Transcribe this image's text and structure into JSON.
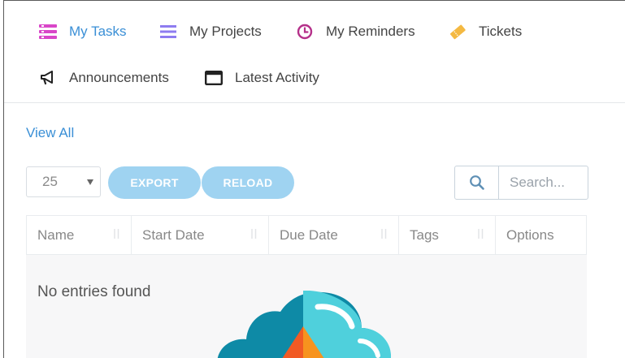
{
  "tabs": [
    {
      "label": "My Tasks",
      "icon": "tasks-icon",
      "active": true
    },
    {
      "label": "My Projects",
      "icon": "projects-icon",
      "active": false
    },
    {
      "label": "My Reminders",
      "icon": "clock-icon",
      "active": false
    },
    {
      "label": "Tickets",
      "icon": "ticket-icon",
      "active": false
    },
    {
      "label": "Announcements",
      "icon": "megaphone-icon",
      "active": false
    },
    {
      "label": "Latest Activity",
      "icon": "window-icon",
      "active": false
    }
  ],
  "view_all": "View All",
  "length_select": {
    "value": "25"
  },
  "buttons": {
    "export": "EXPORT",
    "reload": "RELOAD"
  },
  "search": {
    "placeholder": "Search..."
  },
  "table": {
    "columns": [
      "Name",
      "Start Date",
      "Due Date",
      "Tags",
      "Options"
    ],
    "empty_message": "No entries found"
  },
  "colors": {
    "accent": "#3a8fd6",
    "button": "#9fd3f1",
    "tasks_icon": "#d946c8",
    "projects_icon": "#8e7cf0",
    "reminders_icon": "#b5318a",
    "tickets_icon": "#f4b942"
  }
}
